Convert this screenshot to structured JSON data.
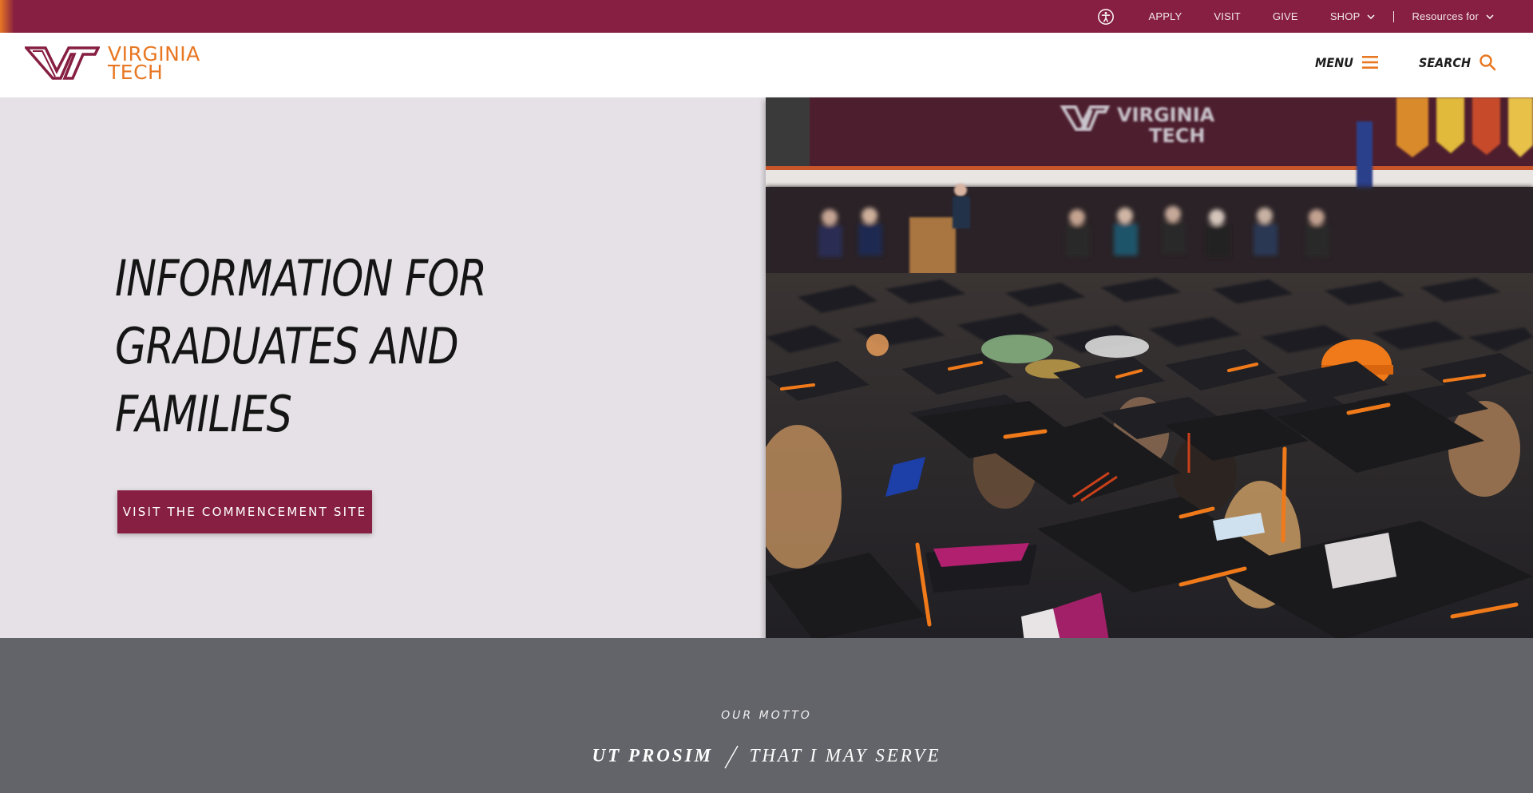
{
  "utility_bar": {
    "accessibility_icon": "accessibility-icon",
    "items": [
      {
        "label": "APPLY"
      },
      {
        "label": "VISIT"
      },
      {
        "label": "GIVE"
      },
      {
        "label": "SHOP",
        "icon": "chevron-down-icon"
      }
    ],
    "resources": {
      "label": "Resources for",
      "icon": "chevron-down-icon"
    }
  },
  "header": {
    "logo": {
      "line1": "VIRGINIA",
      "line2": "TECH",
      "wordmark_color": "#e87722",
      "mark_color": "#861f41"
    },
    "menu_label": "MENU",
    "menu_icon": "hamburger-menu-icon",
    "search_label": "SEARCH",
    "search_icon": "search-icon"
  },
  "hero": {
    "title_lines": [
      "INFORMATION FOR",
      "GRADUATES AND",
      "FAMILIES"
    ],
    "cta_label": "VISIT THE COMMENCEMENT SITE",
    "image_alt": "Graduates in caps and gowns at commencement ceremony",
    "banner_text": {
      "line1": "VIRGINIA",
      "line2": "TECH"
    }
  },
  "motto": {
    "label": "OUR MOTTO",
    "latin": "UT PROSIM",
    "english": "THAT I MAY SERVE"
  },
  "colors": {
    "maroon": "#861f41",
    "orange": "#e87722",
    "hero_bg": "#e5e1e6",
    "motto_bg": "#636469"
  }
}
